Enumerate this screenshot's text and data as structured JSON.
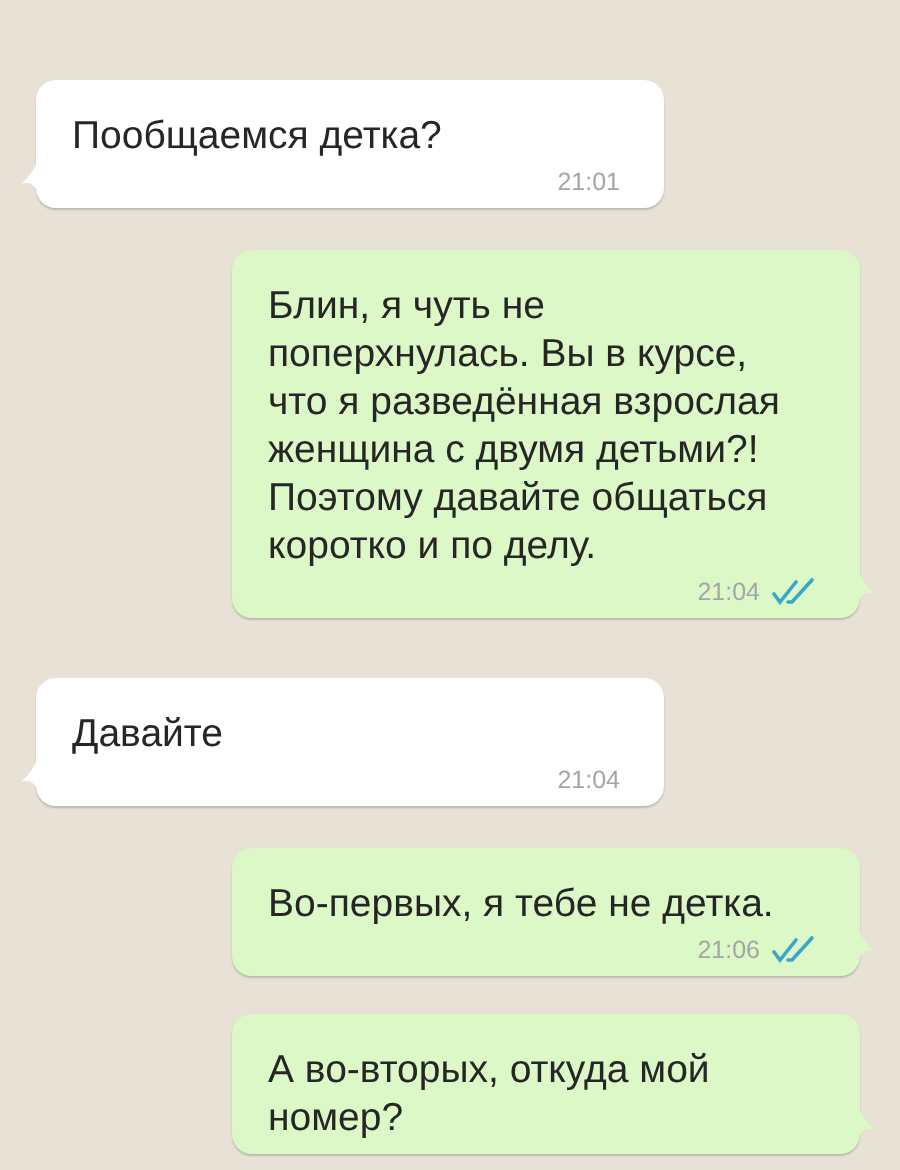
{
  "messages": [
    {
      "kind": "incoming",
      "text": "Пообщаемся детка?",
      "time": "21:01"
    },
    {
      "kind": "outgoing",
      "text": "Блин, я чуть не поперхнулась. Вы в курсе, что я разведённая взрослая женщина с двумя детьми?! Поэтому давайте общаться коротко и по делу.",
      "time": "21:04",
      "read": true
    },
    {
      "kind": "incoming",
      "text": "Давайте",
      "time": "21:04"
    },
    {
      "kind": "outgoing",
      "text": "Во-первых, я тебе не детка.",
      "time": "21:06",
      "read": true
    },
    {
      "kind": "outgoing",
      "text": "А во-вторых, откуда мой номер?"
    }
  ]
}
